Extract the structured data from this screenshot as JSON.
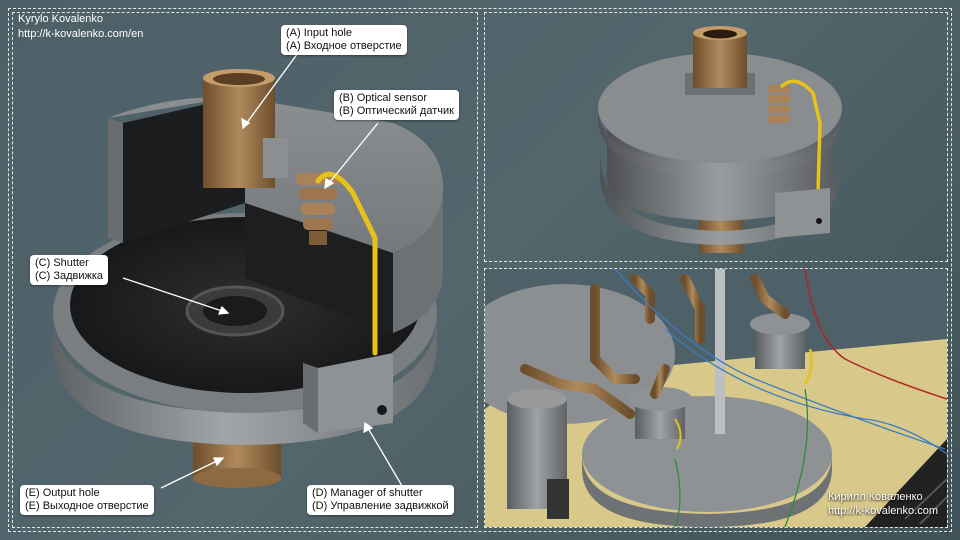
{
  "author": {
    "name": "Kyrylo Kovalenko",
    "url": "http://k-kovalenko.com/en",
    "name_ru": "Кирилл Коваленко",
    "url_ru": "http://k-kovalenko.com"
  },
  "callouts": [
    {
      "en": "(A) Input hole",
      "ru": "(A) Входное отверстие"
    },
    {
      "en": "(B) Optical sensor",
      "ru": "(B) Оптический датчик"
    },
    {
      "en": "(C) Shutter",
      "ru": "(C) Задвижка"
    },
    {
      "en": "(D) Manager of  shutter",
      "ru": "(D) Управление задвижкой"
    },
    {
      "en": "(E) Output hole",
      "ru": "(E) Выходное отверстие"
    }
  ],
  "colors": {
    "background": "#4d6068",
    "metal": "#8a8d90",
    "copper": "#9a7448",
    "wire": "#e6c21a",
    "frame": "#ffffff"
  }
}
